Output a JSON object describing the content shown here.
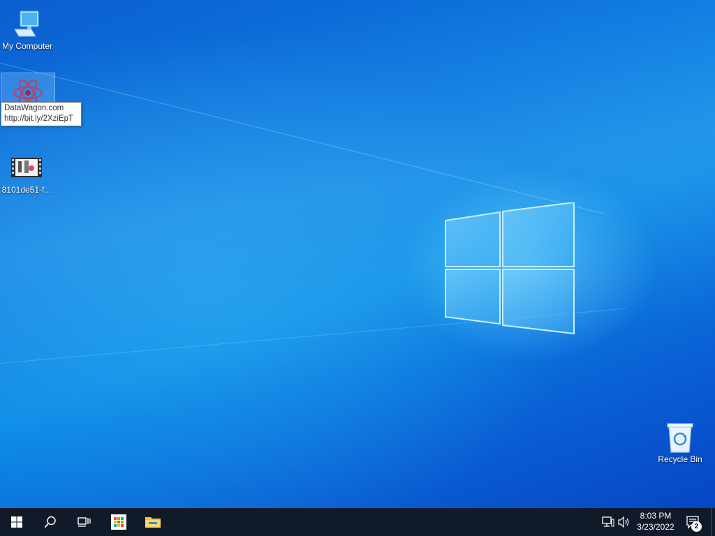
{
  "desktop": {
    "icons": [
      {
        "label": "My Computer",
        "icon": "computer-icon"
      },
      {
        "label": "",
        "icon": "datawagon-icon"
      },
      {
        "label": "8101de51-f...",
        "icon": "video-file-icon"
      },
      {
        "label": "Recycle Bin",
        "icon": "recycle-bin-icon"
      }
    ],
    "tooltip": {
      "line1": "DataWagon.com",
      "line2": "http://bit.ly/2XziEpT"
    }
  },
  "taskbar": {
    "buttons": [
      {
        "icon": "windows-start-icon"
      },
      {
        "icon": "search-icon"
      },
      {
        "icon": "task-view-icon"
      },
      {
        "icon": "store-icon"
      },
      {
        "icon": "file-explorer-icon"
      }
    ],
    "tray": {
      "network_icon": "network-icon",
      "volume_icon": "volume-icon",
      "time": "8:03 PM",
      "date": "3/23/2022",
      "notifications_icon": "action-center-icon",
      "notification_count": "2"
    }
  },
  "colors": {
    "taskbar_bg": "#101a28",
    "desktop_accent": "#0a78e0"
  }
}
